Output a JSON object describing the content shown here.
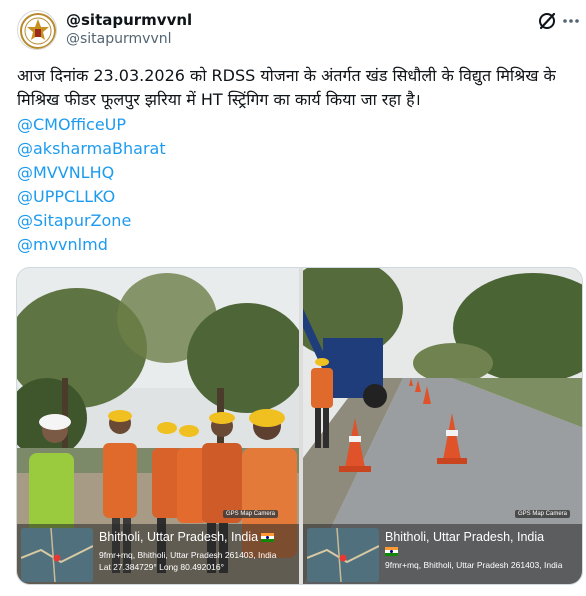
{
  "post": {
    "display_name": "@sitapurmvvnl",
    "handle": "@sitapurmvvnl",
    "avatar_icon": "emblem-logo-icon",
    "text": "आज दिनांक 23.03.2026 को RDSS योजना के अंतर्गत खंड सिधौली के विद्युत मिश्रिख के  मिश्रिख फीडर फूलपुर झरिया में HT  स्ट्रिंगिग का कार्य किया जा रहा है।",
    "mentions": [
      "@CMOfficeUP",
      "@aksharmaBharat",
      "@MVVNLHQ",
      "@UPPCLLKO",
      "@SitapurZone",
      "@mvvnlmd"
    ],
    "mention_color": "#1d9bf0"
  },
  "media": {
    "left": {
      "badge": "GPS Map Camera",
      "location": "Bhitholi, Uttar Pradesh, India",
      "address": "9fmr+mq, Bhitholi, Uttar Pradesh 261403, India",
      "coords": "Lat 27.384729° Long 80.492016°"
    },
    "right": {
      "badge": "GPS Map Camera",
      "location": "Bhitholi, Uttar Pradesh, India",
      "address": "9fmr+mq, Bhitholi, Uttar Pradesh 261403, India"
    }
  }
}
